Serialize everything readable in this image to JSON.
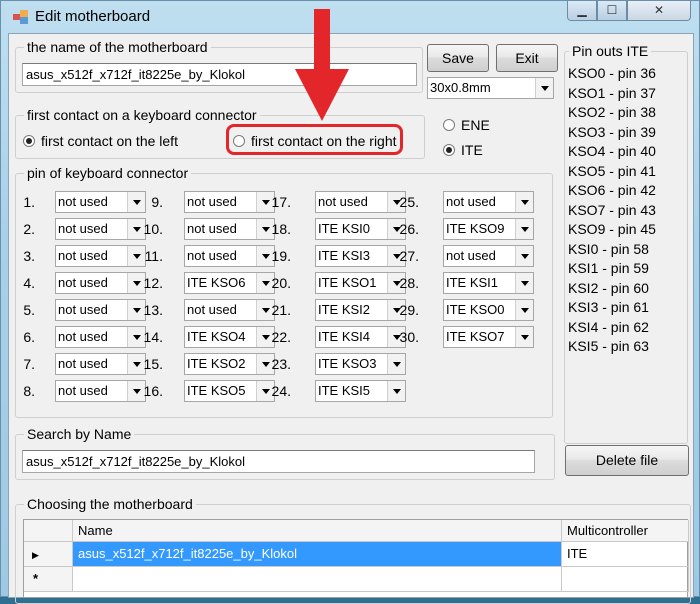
{
  "window": {
    "title": "Edit motherboard"
  },
  "name_group": {
    "legend": "the name of the motherboard",
    "value": "asus_x512f_x712f_it8225e_by_Klokol"
  },
  "buttons": {
    "save": "Save",
    "exit": "Exit",
    "delete_file": "Delete file"
  },
  "connector_type": {
    "selected": "30x0.8mm"
  },
  "first_contact": {
    "legend": "first contact on a keyboard connector",
    "left_label": "first contact on the left",
    "right_label": "first contact on the right",
    "selected": "left"
  },
  "controller": {
    "ene_label": "ENE",
    "ite_label": "ITE",
    "selected": "ITE"
  },
  "pins_group": {
    "legend": "pin of keyboard connector"
  },
  "pins": [
    {
      "n": "1.",
      "v": "not used"
    },
    {
      "n": "2.",
      "v": "not used"
    },
    {
      "n": "3.",
      "v": "not used"
    },
    {
      "n": "4.",
      "v": "not used"
    },
    {
      "n": "5.",
      "v": "not used"
    },
    {
      "n": "6.",
      "v": "not used"
    },
    {
      "n": "7.",
      "v": "not used"
    },
    {
      "n": "8.",
      "v": "not used"
    },
    {
      "n": "9.",
      "v": "not used"
    },
    {
      "n": "10.",
      "v": "not used"
    },
    {
      "n": "11.",
      "v": "not used"
    },
    {
      "n": "12.",
      "v": "ITE KSO6"
    },
    {
      "n": "13.",
      "v": "not used"
    },
    {
      "n": "14.",
      "v": "ITE KSO4"
    },
    {
      "n": "15.",
      "v": "ITE KSO2"
    },
    {
      "n": "16.",
      "v": "ITE KSO5"
    },
    {
      "n": "17.",
      "v": "not used"
    },
    {
      "n": "18.",
      "v": "ITE KSI0"
    },
    {
      "n": "19.",
      "v": "ITE KSI3"
    },
    {
      "n": "20.",
      "v": "ITE KSO1"
    },
    {
      "n": "21.",
      "v": "ITE KSI2"
    },
    {
      "n": "22.",
      "v": "ITE KSI4"
    },
    {
      "n": "23.",
      "v": "ITE KSO3"
    },
    {
      "n": "24.",
      "v": "ITE KSI5"
    },
    {
      "n": "25.",
      "v": "not used"
    },
    {
      "n": "26.",
      "v": "ITE KSO9"
    },
    {
      "n": "27.",
      "v": "not used"
    },
    {
      "n": "28.",
      "v": "ITE KSI1"
    },
    {
      "n": "29.",
      "v": "ITE KSO0"
    },
    {
      "n": "30.",
      "v": "ITE KSO7"
    }
  ],
  "pinouts": {
    "legend": "Pin outs ITE",
    "lines": [
      "KSO0 - pin 36",
      "KSO1 - pin 37",
      "KSO2 - pin 38",
      "KSO3 - pin 39",
      "KSO4 - pin 40",
      "KSO5 - pin 41",
      "KSO6 - pin 42",
      "KSO7 - pin 43",
      "KSO9 - pin 45",
      "KSI0  - pin 58",
      "KSI1  - pin 59",
      "KSI2  - pin 60",
      "KSI3  - pin 61",
      "KSI4  - pin 62",
      "KSI5  - pin 63"
    ]
  },
  "search": {
    "legend": "Search by Name",
    "value": "asus_x512f_x712f_it8225e_by_Klokol"
  },
  "choose": {
    "legend": "Choosing the motherboard",
    "columns": [
      "Name",
      "Multicontroller"
    ],
    "rows": [
      {
        "name": "asus_x512f_x712f_it8225e_by_Klokol",
        "controller": "ITE"
      }
    ],
    "new_row_marker": "*"
  },
  "colors": {
    "annotation": "#e3262a",
    "selection": "#3399ff"
  }
}
